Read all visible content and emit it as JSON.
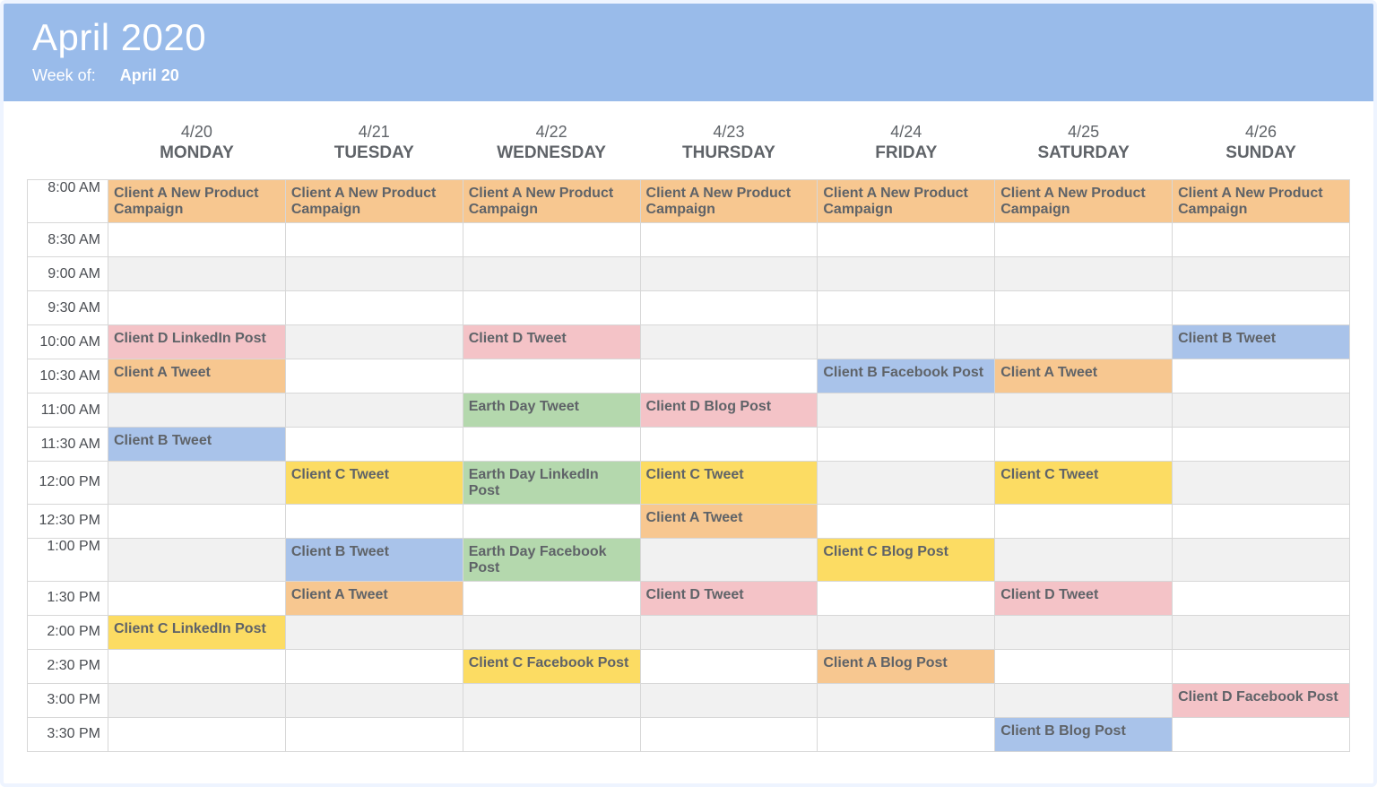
{
  "header": {
    "title": "April 2020",
    "week_label": "Week of:",
    "week_value": "April 20"
  },
  "days": [
    {
      "date": "4/20",
      "dow": "MONDAY"
    },
    {
      "date": "4/21",
      "dow": "TUESDAY"
    },
    {
      "date": "4/22",
      "dow": "WEDNESDAY"
    },
    {
      "date": "4/23",
      "dow": "THURSDAY"
    },
    {
      "date": "4/24",
      "dow": "FRIDAY"
    },
    {
      "date": "4/25",
      "dow": "SATURDAY"
    },
    {
      "date": "4/26",
      "dow": "SUNDAY"
    }
  ],
  "times": [
    "8:00 AM",
    "8:30 AM",
    "9:00 AM",
    "9:30 AM",
    "10:00 AM",
    "10:30 AM",
    "11:00 AM",
    "11:30 AM",
    "12:00 PM",
    "12:30 PM",
    "1:00 PM",
    "1:30 PM",
    "2:00 PM",
    "2:30 PM",
    "3:00 PM",
    "3:30 PM"
  ],
  "events": {
    "campaign": "Client A New Product Campaign",
    "d_linkedin": "Client D LinkedIn Post",
    "d_tweet": "Client D Tweet",
    "b_tweet": "Client B Tweet",
    "a_tweet": "Client A Tweet",
    "b_fb": "Client B Facebook Post",
    "earth_tweet": "Earth Day Tweet",
    "d_blog": "Client D Blog Post",
    "c_tweet": "Client C Tweet",
    "earth_li": "Earth Day LinkedIn Post",
    "earth_fb": "Earth Day Facebook Post",
    "c_blog": "Client C Blog Post",
    "c_linkedin": "Client C LinkedIn Post",
    "c_fb": "Client C Facebook Post",
    "a_blog": "Client A Blog Post",
    "d_fb": "Client D Facebook Post",
    "b_blog": "Client B Blog Post"
  }
}
